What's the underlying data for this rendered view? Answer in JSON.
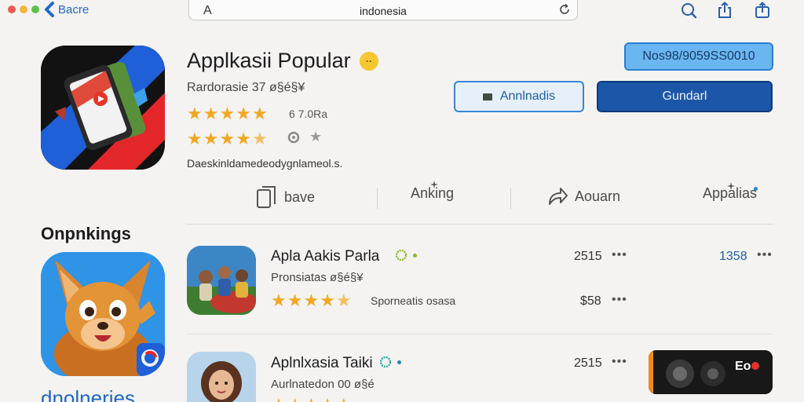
{
  "browser": {
    "back_label": "Bacre",
    "url_letter": "A",
    "url": "indonesia"
  },
  "hero": {
    "title": "Applkasii Popular",
    "badge": "··",
    "subtitle": "Rardorasie 37 ø§é§¥",
    "rating_text": "6 7.0Ra",
    "description": "Daeskinldamedeodygnlameol.s.",
    "rating_primary": 5,
    "rating_secondary": 4.5
  },
  "buttons": {
    "top": "Nos98/9059SS0010",
    "left": "Annlnadis",
    "right": "Gundarl"
  },
  "actions": [
    {
      "label": "bave",
      "icon": "bookmark-icon"
    },
    {
      "label": "Anking",
      "icon": "sparkle-icon"
    },
    {
      "label": "Aouarn",
      "icon": "share-arrow-icon"
    },
    {
      "label": "Appalias",
      "icon": "sparkle-icon"
    }
  ],
  "section": {
    "title": "Onpnkings",
    "bottom_text": "dnolneries"
  },
  "list": [
    {
      "title": "Apla Aakis Parla",
      "subtitle": "Pronsiatas ø§é§¥",
      "rating": 4.5,
      "rating_text": "Sporneatis osasa",
      "num1": "2515",
      "num2": "1358",
      "num3": "$58"
    },
    {
      "title": "Aplnlxasia Taiki",
      "subtitle": "Aurlnatedon 00 ø§é",
      "num1": "2515",
      "thumb_text": "Eo"
    }
  ],
  "colors": {
    "accent": "#1c56a8",
    "star": "#f1a824",
    "link": "#2369c8"
  }
}
